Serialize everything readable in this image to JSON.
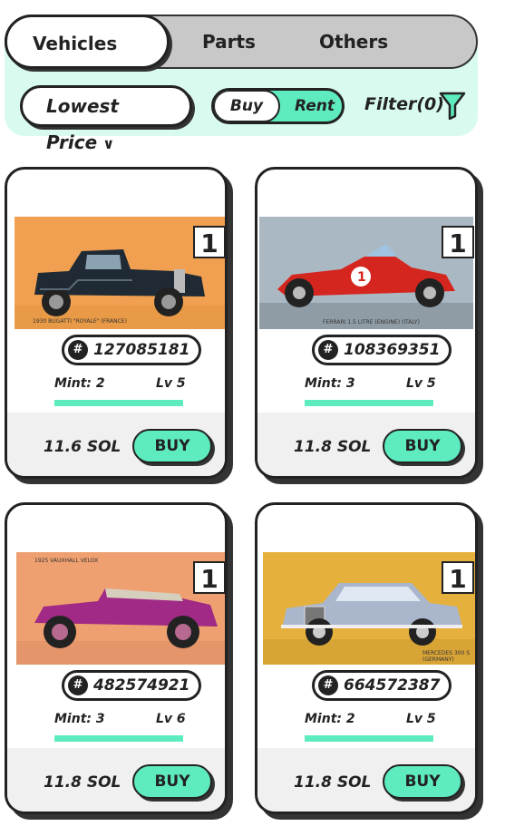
{
  "tabs": {
    "vehicles": "Vehicles",
    "parts": "Parts",
    "others": "Others"
  },
  "filters": {
    "sort_label": "Lowest Price",
    "sort_chevron": "∨",
    "toggle_buy": "Buy",
    "toggle_rent": "Rent",
    "filter_label": "Filter(0)"
  },
  "colors": {
    "accent": "#5eebbf",
    "panel": "#d9fbef"
  },
  "cards": [
    {
      "badge": "1",
      "caption": "1930 BUGATTI \"ROYALE\" (FRANCE)",
      "id": "127085181",
      "mint": "Mint: 2",
      "level": "Lv 5",
      "price": "11.6 SOL",
      "button": "BUY"
    },
    {
      "badge": "1",
      "caption": "FERRARI 1.5 LITRE (ENGINE) (ITALY)",
      "id": "108369351",
      "mint": "Mint: 3",
      "level": "Lv 5",
      "price": "11.8 SOL",
      "button": "BUY"
    },
    {
      "badge": "1",
      "caption": "1925 VAUXHALL VELOX",
      "id": "482574921",
      "mint": "Mint: 3",
      "level": "Lv 6",
      "price": "11.8 SOL",
      "button": "BUY"
    },
    {
      "badge": "1",
      "caption": "MERCEDES 300 S (GERMANY)",
      "id": "664572387",
      "mint": "Mint: 2",
      "level": "Lv 5",
      "price": "11.8 SOL",
      "button": "BUY"
    }
  ]
}
